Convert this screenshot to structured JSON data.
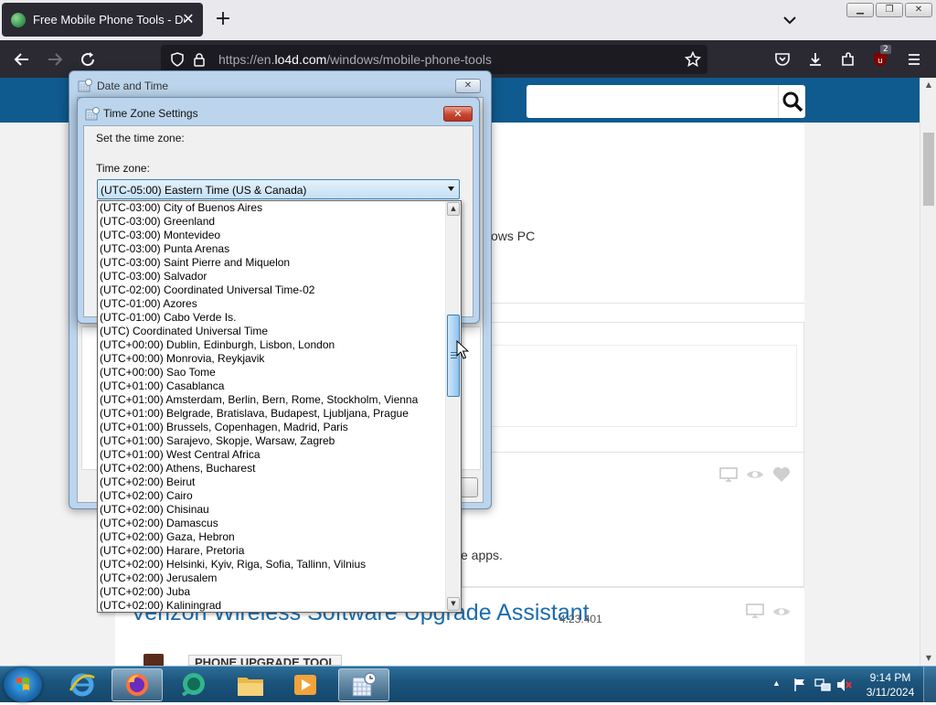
{
  "browser": {
    "tab_title": "Free Mobile Phone Tools - Dow",
    "tab_close": "✕",
    "new_tab": "+",
    "url_scheme": "https://en.",
    "url_domain": "lo4d.com",
    "url_path": "/windows/mobile-phone-tools",
    "extension_badge": "2"
  },
  "page": {
    "snippet_platform": "ows PC",
    "snippet_apps": "bile apps.",
    "app_title": "Verizon Wireless Software Upgrade Assistant",
    "app_version": "4.23.401",
    "tag_label": "PHONE UPGRADE TOOL"
  },
  "date_time_dialog": {
    "title": "Date and Time",
    "close": "✕"
  },
  "tz_dialog": {
    "title": "Time Zone Settings",
    "close": "✕",
    "instruction": "Set the time zone:",
    "timezone_label": "Time zone:",
    "selected": "(UTC-05:00) Eastern Time (US & Canada)"
  },
  "tz_options": [
    "(UTC-03:00) City of Buenos Aires",
    "(UTC-03:00) Greenland",
    "(UTC-03:00) Montevideo",
    "(UTC-03:00) Punta Arenas",
    "(UTC-03:00) Saint Pierre and Miquelon",
    "(UTC-03:00) Salvador",
    "(UTC-02:00) Coordinated Universal Time-02",
    "(UTC-01:00) Azores",
    "(UTC-01:00) Cabo Verde Is.",
    "(UTC) Coordinated Universal Time",
    "(UTC+00:00) Dublin, Edinburgh, Lisbon, London",
    "(UTC+00:00) Monrovia, Reykjavik",
    "(UTC+00:00) Sao Tome",
    "(UTC+01:00) Casablanca",
    "(UTC+01:00) Amsterdam, Berlin, Bern, Rome, Stockholm, Vienna",
    "(UTC+01:00) Belgrade, Bratislava, Budapest, Ljubljana, Prague",
    "(UTC+01:00) Brussels, Copenhagen, Madrid, Paris",
    "(UTC+01:00) Sarajevo, Skopje, Warsaw, Zagreb",
    "(UTC+01:00) West Central Africa",
    "(UTC+02:00) Athens, Bucharest",
    "(UTC+02:00) Beirut",
    "(UTC+02:00) Cairo",
    "(UTC+02:00) Chisinau",
    "(UTC+02:00) Damascus",
    "(UTC+02:00) Gaza, Hebron",
    "(UTC+02:00) Harare, Pretoria",
    "(UTC+02:00) Helsinki, Kyiv, Riga, Sofia, Tallinn, Vilnius",
    "(UTC+02:00) Jerusalem",
    "(UTC+02:00) Juba",
    "(UTC+02:00) Kaliningrad"
  ],
  "taskbar": {
    "time": "9:14 PM",
    "date": "3/11/2024"
  },
  "colors": {
    "site_header": "#0f5a8e",
    "browser_dark": "#2b2a33",
    "dialog_frame": "#bcd5ec",
    "close_red": "#c8452e",
    "link_blue": "#1b6cae"
  }
}
